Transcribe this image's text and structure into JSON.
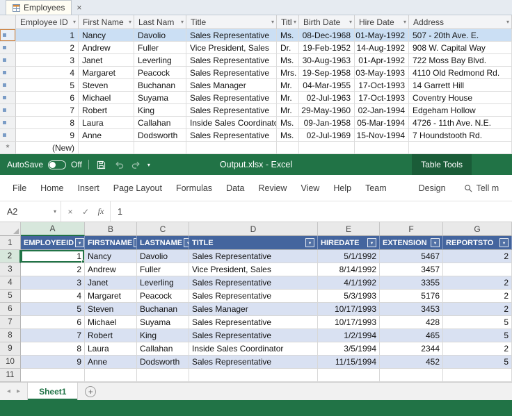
{
  "icons": {
    "caret": "▾",
    "close": "×",
    "cancel": "×",
    "check": "✓",
    "fx": "fx",
    "nav_left": "◂",
    "nav_right": "▸",
    "plus": "+"
  },
  "colors": {
    "excel_green": "#217346",
    "table_tools_green": "#1a5c38",
    "table_header_blue": "#44659e",
    "band_blue": "#d9e1f2",
    "access_selection_blue": "#cbdff4"
  },
  "access": {
    "tab_label": "Employees",
    "columns": [
      "Employee ID",
      "First Name",
      "Last Nam",
      "Title",
      "Titl",
      "Birth Date",
      "Hire Date",
      "Address"
    ],
    "rows": [
      [
        "1",
        "Nancy",
        "Davolio",
        "Sales Representative",
        "Ms.",
        "08-Dec-1968",
        "01-May-1992",
        "507 - 20th Ave. E."
      ],
      [
        "2",
        "Andrew",
        "Fuller",
        "Vice President, Sales",
        "Dr.",
        "19-Feb-1952",
        "14-Aug-1992",
        "908 W. Capital Way"
      ],
      [
        "3",
        "Janet",
        "Leverling",
        "Sales Representative",
        "Ms.",
        "30-Aug-1963",
        "01-Apr-1992",
        "722 Moss Bay Blvd."
      ],
      [
        "4",
        "Margaret",
        "Peacock",
        "Sales Representative",
        "Mrs.",
        "19-Sep-1958",
        "03-May-1993",
        "4110 Old Redmond Rd."
      ],
      [
        "5",
        "Steven",
        "Buchanan",
        "Sales Manager",
        "Mr.",
        "04-Mar-1955",
        "17-Oct-1993",
        "14 Garrett Hill"
      ],
      [
        "6",
        "Michael",
        "Suyama",
        "Sales Representative",
        "Mr.",
        "02-Jul-1963",
        "17-Oct-1993",
        "Coventry House"
      ],
      [
        "7",
        "Robert",
        "King",
        "Sales Representative",
        "Mr.",
        "29-May-1960",
        "02-Jan-1994",
        "Edgeham Hollow"
      ],
      [
        "8",
        "Laura",
        "Callahan",
        "Inside Sales Coordinato",
        "Ms.",
        "09-Jan-1958",
        "05-Mar-1994",
        "4726 - 11th Ave. N.E."
      ],
      [
        "9",
        "Anne",
        "Dodsworth",
        "Sales Representative",
        "Ms.",
        "02-Jul-1969",
        "15-Nov-1994",
        "7 Houndstooth Rd."
      ]
    ],
    "new_row": {
      "selector": "*",
      "label": "(New)"
    }
  },
  "excel": {
    "titlebar": {
      "autosave_label": "AutoSave",
      "autosave_state": "Off",
      "title": "Output.xlsx - Excel",
      "contextual_tab": "Table Tools"
    },
    "ribbon_tabs": [
      "File",
      "Home",
      "Insert",
      "Page Layout",
      "Formulas",
      "Data",
      "Review",
      "View",
      "Help",
      "Team",
      "Design"
    ],
    "tell_me": "Tell m",
    "formula_bar": {
      "name_box": "A2",
      "value": "1"
    },
    "grid": {
      "column_letters": [
        "A",
        "B",
        "C",
        "D",
        "E",
        "F",
        "G"
      ],
      "row_numbers": [
        "1",
        "2",
        "3",
        "4",
        "5",
        "6",
        "7",
        "8",
        "9",
        "10",
        "11"
      ],
      "headers": [
        "EMPLOYEEID",
        "FIRSTNAME",
        "LASTNAME",
        "TITLE",
        "HIREDATE",
        "EXTENSION",
        "REPORTSTO"
      ],
      "rows": [
        [
          "1",
          "Nancy",
          "Davolio",
          "Sales Representative",
          "5/1/1992",
          "5467",
          "2"
        ],
        [
          "2",
          "Andrew",
          "Fuller",
          "Vice President, Sales",
          "8/14/1992",
          "3457",
          ""
        ],
        [
          "3",
          "Janet",
          "Leverling",
          "Sales Representative",
          "4/1/1992",
          "3355",
          "2"
        ],
        [
          "4",
          "Margaret",
          "Peacock",
          "Sales Representative",
          "5/3/1993",
          "5176",
          "2"
        ],
        [
          "5",
          "Steven",
          "Buchanan",
          "Sales Manager",
          "10/17/1993",
          "3453",
          "2"
        ],
        [
          "6",
          "Michael",
          "Suyama",
          "Sales Representative",
          "10/17/1993",
          "428",
          "5"
        ],
        [
          "7",
          "Robert",
          "King",
          "Sales Representative",
          "1/2/1994",
          "465",
          "5"
        ],
        [
          "8",
          "Laura",
          "Callahan",
          "Inside Sales Coordinator",
          "3/5/1994",
          "2344",
          "2"
        ],
        [
          "9",
          "Anne",
          "Dodsworth",
          "Sales Representative",
          "11/15/1994",
          "452",
          "5"
        ]
      ]
    },
    "sheet_tab": "Sheet1"
  }
}
